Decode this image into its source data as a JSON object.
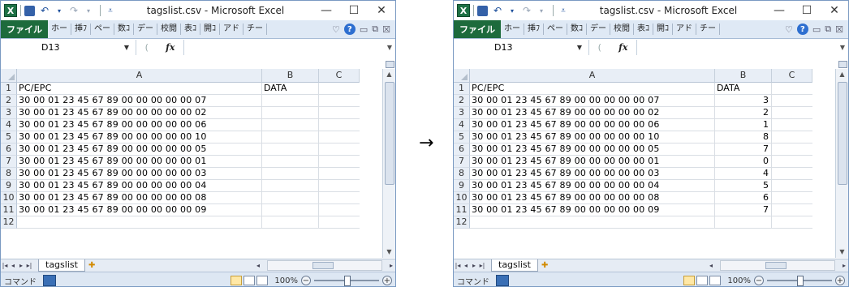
{
  "arrow": "→",
  "windows": [
    {
      "id": "before",
      "app_icon": "X",
      "title": "tagslist.csv - Microsoft Excel",
      "ribbon_tabs": [
        "ファイル",
        "ホー",
        "挿ﾌ",
        "ペー",
        "数ｺ",
        "デー",
        "校閲",
        "表ｺ",
        "開ｺ",
        "アド",
        "チー"
      ],
      "name_box": "D13",
      "fx": "fx",
      "columns": [
        "A",
        "B",
        "C"
      ],
      "rows": [
        {
          "n": "1",
          "a": "PC/EPC",
          "b": "DATA"
        },
        {
          "n": "2",
          "a": "30 00 01 23 45 67 89 00 00 00 00 00 07",
          "b": ""
        },
        {
          "n": "3",
          "a": "30 00 01 23 45 67 89 00 00 00 00 00 02",
          "b": ""
        },
        {
          "n": "4",
          "a": "30 00 01 23 45 67 89 00 00 00 00 00 06",
          "b": ""
        },
        {
          "n": "5",
          "a": "30 00 01 23 45 67 89 00 00 00 00 00 10",
          "b": ""
        },
        {
          "n": "6",
          "a": "30 00 01 23 45 67 89 00 00 00 00 00 05",
          "b": ""
        },
        {
          "n": "7",
          "a": "30 00 01 23 45 67 89 00 00 00 00 00 01",
          "b": ""
        },
        {
          "n": "8",
          "a": "30 00 01 23 45 67 89 00 00 00 00 00 03",
          "b": ""
        },
        {
          "n": "9",
          "a": "30 00 01 23 45 67 89 00 00 00 00 00 04",
          "b": ""
        },
        {
          "n": "10",
          "a": "30 00 01 23 45 67 89 00 00 00 00 00 08",
          "b": ""
        },
        {
          "n": "11",
          "a": "30 00 01 23 45 67 89 00 00 00 00 00 09",
          "b": ""
        },
        {
          "n": "12",
          "a": "",
          "b": ""
        }
      ],
      "sheet_tab": "tagslist",
      "status_mode": "コマンド",
      "zoom": "100%"
    },
    {
      "id": "after",
      "app_icon": "X",
      "title": "tagslist.csv - Microsoft Excel",
      "ribbon_tabs": [
        "ファイル",
        "ホー",
        "挿ﾌ",
        "ペー",
        "数ｺ",
        "デー",
        "校閲",
        "表ｺ",
        "開ｺ",
        "アド",
        "チー"
      ],
      "name_box": "D13",
      "fx": "fx",
      "columns": [
        "A",
        "B",
        "C"
      ],
      "rows": [
        {
          "n": "1",
          "a": "PC/EPC",
          "b": "DATA"
        },
        {
          "n": "2",
          "a": "30 00 01 23 45 67 89 00 00 00 00 00 07",
          "b": "3"
        },
        {
          "n": "3",
          "a": "30 00 01 23 45 67 89 00 00 00 00 00 02",
          "b": "2"
        },
        {
          "n": "4",
          "a": "30 00 01 23 45 67 89 00 00 00 00 00 06",
          "b": "1"
        },
        {
          "n": "5",
          "a": "30 00 01 23 45 67 89 00 00 00 00 00 10",
          "b": "8"
        },
        {
          "n": "6",
          "a": "30 00 01 23 45 67 89 00 00 00 00 00 05",
          "b": "7"
        },
        {
          "n": "7",
          "a": "30 00 01 23 45 67 89 00 00 00 00 00 01",
          "b": "0"
        },
        {
          "n": "8",
          "a": "30 00 01 23 45 67 89 00 00 00 00 00 03",
          "b": "4"
        },
        {
          "n": "9",
          "a": "30 00 01 23 45 67 89 00 00 00 00 00 04",
          "b": "5"
        },
        {
          "n": "10",
          "a": "30 00 01 23 45 67 89 00 00 00 00 00 08",
          "b": "6"
        },
        {
          "n": "11",
          "a": "30 00 01 23 45 67 89 00 00 00 00 00 09",
          "b": "7"
        },
        {
          "n": "12",
          "a": "",
          "b": ""
        }
      ],
      "sheet_tab": "tagslist",
      "status_mode": "コマンド",
      "zoom": "100%"
    }
  ]
}
